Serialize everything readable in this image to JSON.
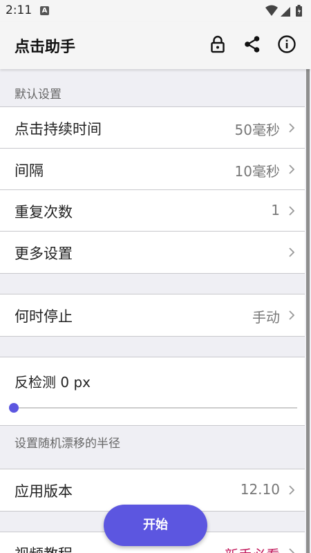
{
  "status_bar": {
    "time": "2:11",
    "notification_icon": "A"
  },
  "app_bar": {
    "title": "点击助手",
    "icons": [
      "lock-icon",
      "share-icon",
      "info-icon"
    ]
  },
  "default_settings": {
    "header": "默认设置",
    "rows": [
      {
        "label": "点击持续时间",
        "value": "50毫秒"
      },
      {
        "label": "间隔",
        "value": "10毫秒"
      },
      {
        "label": "重复次数",
        "value": "1"
      },
      {
        "label": "更多设置",
        "value": ""
      }
    ]
  },
  "stop": {
    "label": "何时停止",
    "value": "手动"
  },
  "anti_detect": {
    "label": "反检测 0 px",
    "slider_value": 0,
    "description": "设置随机漂移的半径"
  },
  "version": {
    "label": "应用版本",
    "value": "12.10"
  },
  "tutorial": {
    "label": "视频教程",
    "value": "新手必看",
    "value_color": "#c2185b"
  },
  "fab_label": "开始",
  "colors": {
    "accent": "#5c56e0",
    "background": "#efeff4"
  }
}
